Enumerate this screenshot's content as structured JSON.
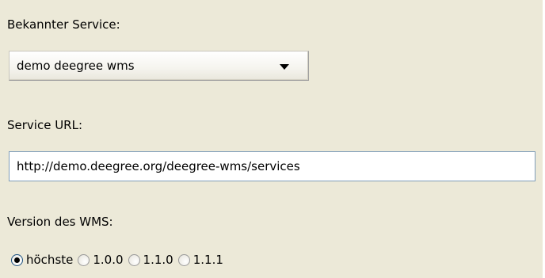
{
  "service_label": "Bekannter Service:",
  "service_select": {
    "value": "demo deegree wms",
    "icon": "chevron-down-icon"
  },
  "url_label": "Service URL:",
  "url_input": {
    "value": "http://demo.deegree.org/deegree-wms/services"
  },
  "version_label": "Version des WMS:",
  "version_options": [
    {
      "label": "höchste",
      "checked": true
    },
    {
      "label": "1.0.0",
      "checked": false
    },
    {
      "label": "1.1.0",
      "checked": false
    },
    {
      "label": "1.1.1",
      "checked": false
    }
  ]
}
